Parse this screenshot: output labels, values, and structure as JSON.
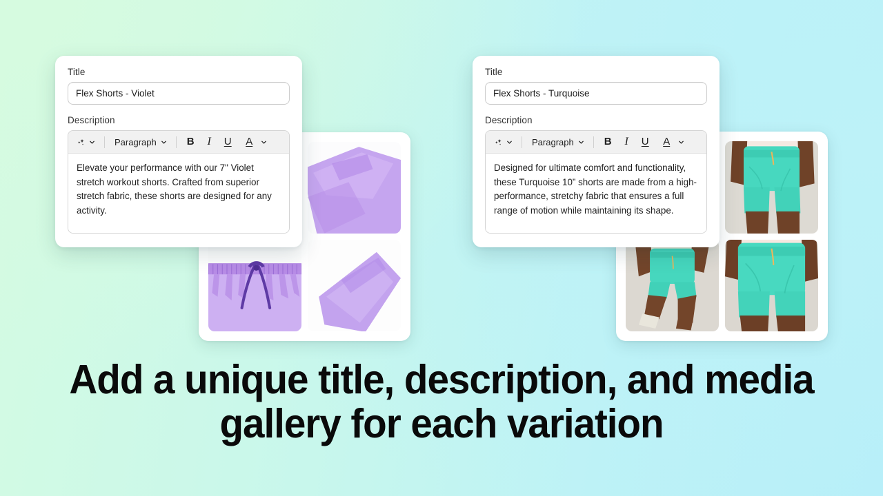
{
  "background": {
    "gradient_from": "#d4fbe2",
    "gradient_to": "#b6eef9"
  },
  "headline": {
    "line1": "Add a unique title, description, and media",
    "line2": "gallery for each variation"
  },
  "toolbar": {
    "ai_icon": "sparkle-icon",
    "ai_caret": "chevron-down-icon",
    "block_style": "Paragraph",
    "block_caret": "chevron-down-icon",
    "bold": "B",
    "italic": "I",
    "underline": "U",
    "text_color": "A",
    "color_caret": "chevron-down-icon"
  },
  "cards": [
    {
      "id": "violet",
      "title_label": "Title",
      "title_value": "Flex Shorts - Violet",
      "title_placeholder": "Title",
      "description_label": "Description",
      "description_value": "Elevate your performance with our 7\" Violet stretch workout shorts. Crafted from superior stretch fabric, these shorts are designed for any activity.",
      "accent_color": "#b99ae8"
    },
    {
      "id": "turquoise",
      "title_label": "Title",
      "title_value": "Flex Shorts - Turquoise",
      "title_placeholder": "Title",
      "description_label": "Description",
      "description_value": "Designed for ultimate comfort and functionality, these Turquoise 10” shorts are made from a high-performance, stretchy fabric that ensures a full range of motion while maintaining its shape.",
      "accent_color": "#45d6c0"
    }
  ],
  "galleries": [
    {
      "id": "violet-gallery",
      "color": "#c6a6f0",
      "thumbs": [
        {
          "name": "violet-shorts-waistband-detail",
          "kind": "product-closeup"
        },
        {
          "name": "violet-shorts-folded",
          "kind": "product-flat"
        },
        {
          "name": "violet-shorts-drawcord-detail",
          "kind": "product-closeup"
        },
        {
          "name": "violet-shorts-fabric-detail",
          "kind": "product-closeup"
        }
      ]
    },
    {
      "id": "turquoise-gallery",
      "color": "#47d5be",
      "thumbs": [
        {
          "name": "turquoise-shorts-model-front",
          "kind": "model-photo"
        },
        {
          "name": "turquoise-shorts-model-side",
          "kind": "model-photo"
        },
        {
          "name": "turquoise-shorts-model-walking",
          "kind": "model-photo"
        },
        {
          "name": "turquoise-shorts-model-closeup",
          "kind": "model-photo"
        }
      ]
    }
  ]
}
